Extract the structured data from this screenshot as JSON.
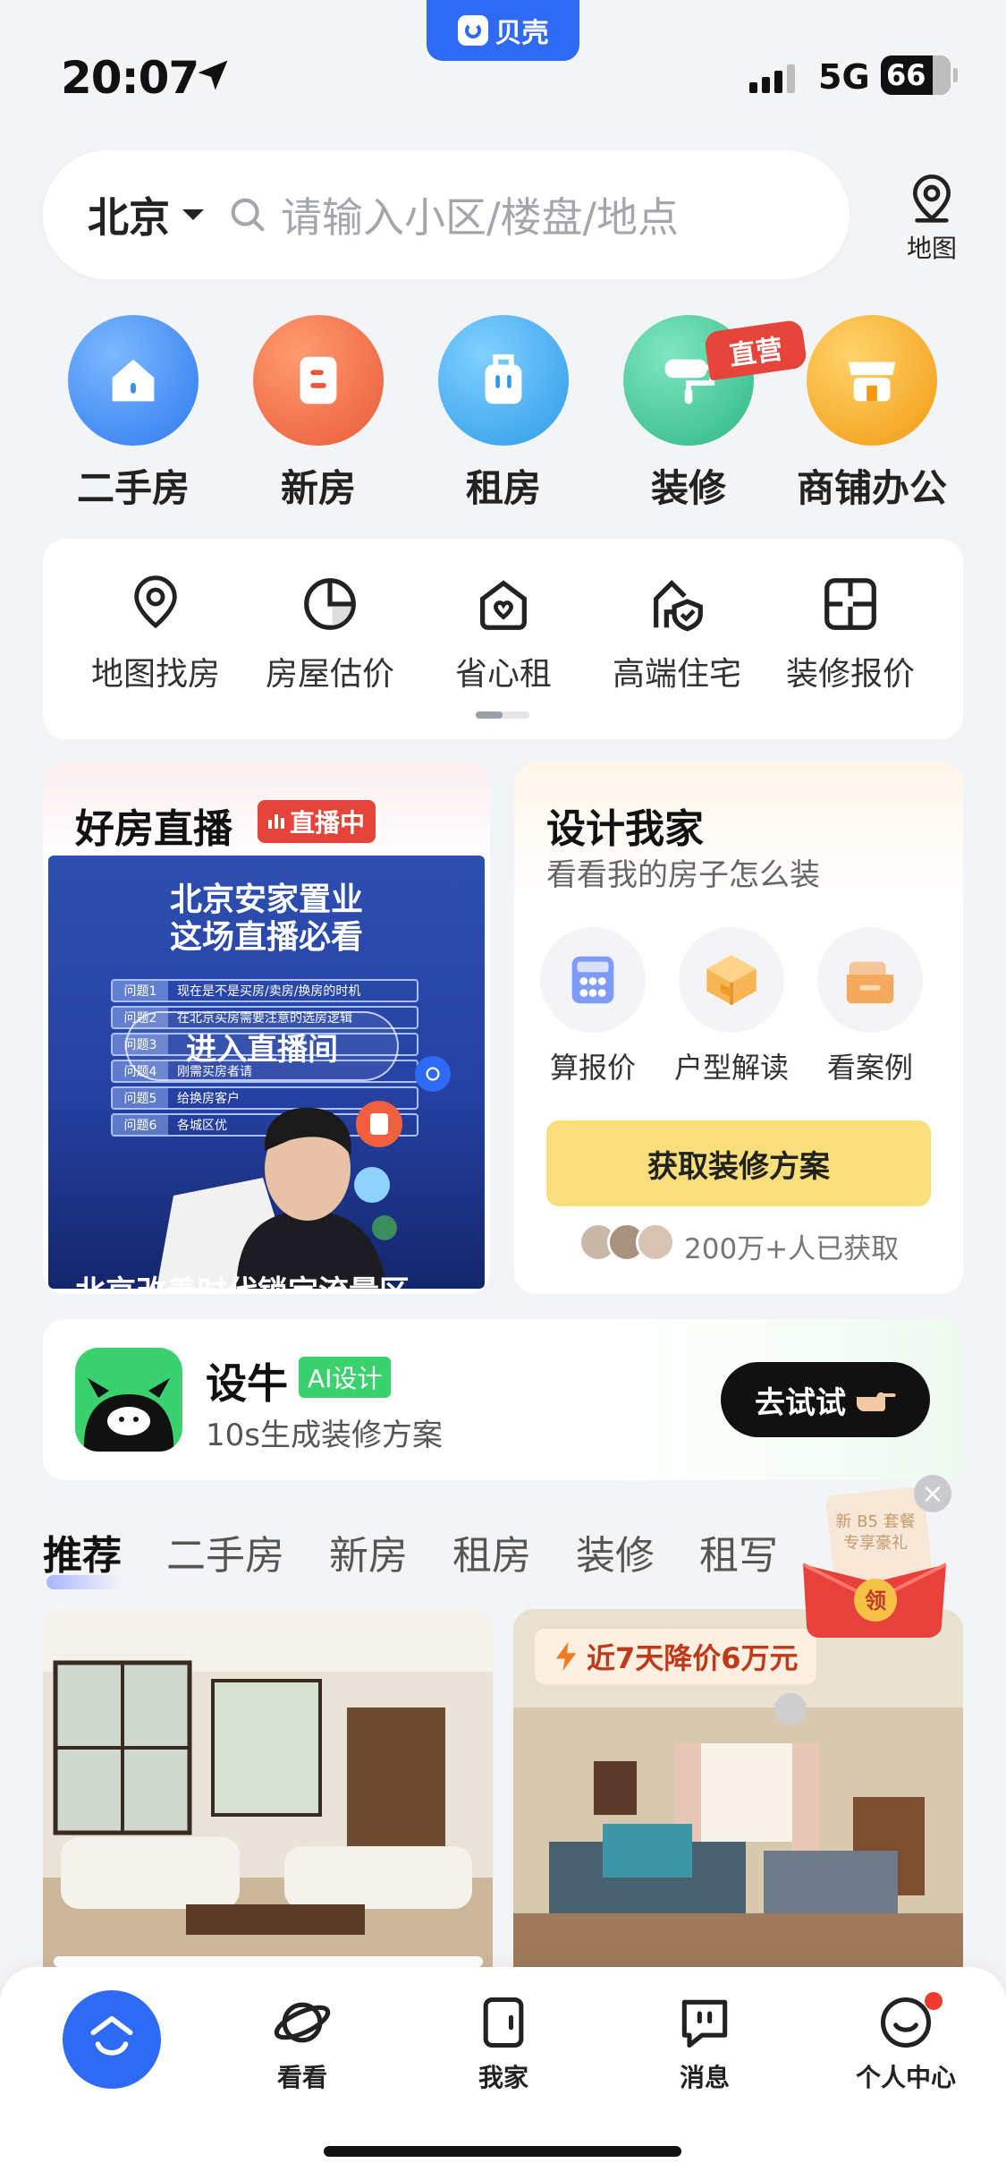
{
  "status_bar": {
    "app_name": "贝壳",
    "time": "20:07",
    "network": "5G",
    "battery": "66"
  },
  "search": {
    "city": "北京",
    "placeholder": "请输入小区/楼盘/地点",
    "map_label": "地图"
  },
  "categories": [
    {
      "label": "二手房",
      "color": "#3d8df7"
    },
    {
      "label": "新房",
      "color": "#f06a48"
    },
    {
      "label": "租房",
      "color": "#3aa8f0"
    },
    {
      "label": "装修",
      "color": "#3ec79a",
      "badge": "直营"
    },
    {
      "label": "商铺办公",
      "color": "#f6a623"
    }
  ],
  "sub_entries": [
    {
      "label": "地图找房",
      "icon": "map-pin-icon"
    },
    {
      "label": "房屋估价",
      "icon": "pie-chart-icon"
    },
    {
      "label": "省心租",
      "icon": "house-heart-icon"
    },
    {
      "label": "高端住宅",
      "icon": "house-shield-icon"
    },
    {
      "label": "装修报价",
      "icon": "floorplan-icon"
    }
  ],
  "live": {
    "title": "好房直播",
    "badge": "直播中",
    "headline_1": "北京安家置业",
    "headline_2": "这场直播必看",
    "enter": "进入直播间",
    "caption": "北京改善时代锁定流量区域",
    "questions": [
      {
        "no": "问题1",
        "text": "现在是不是买房/卖房/换房的时机"
      },
      {
        "no": "问题2",
        "text": "在北京买房需要注意的选房逻辑"
      },
      {
        "no": "问题3",
        "text": ""
      },
      {
        "no": "问题4",
        "text": "刚需买房者请"
      },
      {
        "no": "问题5",
        "text": "给换房客户"
      },
      {
        "no": "问题6",
        "text": "各城区优"
      }
    ]
  },
  "design": {
    "title": "设计我家",
    "subtitle": "看看我的房子怎么装",
    "tools": [
      {
        "label": "算报价"
      },
      {
        "label": "户型解读"
      },
      {
        "label": "看案例"
      }
    ],
    "cta": "获取装修方案",
    "count": "200万+人已获取"
  },
  "ai_banner": {
    "name": "设牛",
    "tag": "AI设计",
    "desc": "10s生成装修方案",
    "cta": "去试试"
  },
  "feed_tabs": [
    "推荐",
    "二手房",
    "新房",
    "租房",
    "装修",
    "租写"
  ],
  "promo": {
    "line1": "新 B5 套餐",
    "line2": "专享豪礼",
    "button": "领"
  },
  "listing_badge": "近7天降价6万元",
  "bottom_nav": [
    {
      "label": "看看"
    },
    {
      "label": "我家"
    },
    {
      "label": "消息"
    },
    {
      "label": "个人中心"
    }
  ]
}
